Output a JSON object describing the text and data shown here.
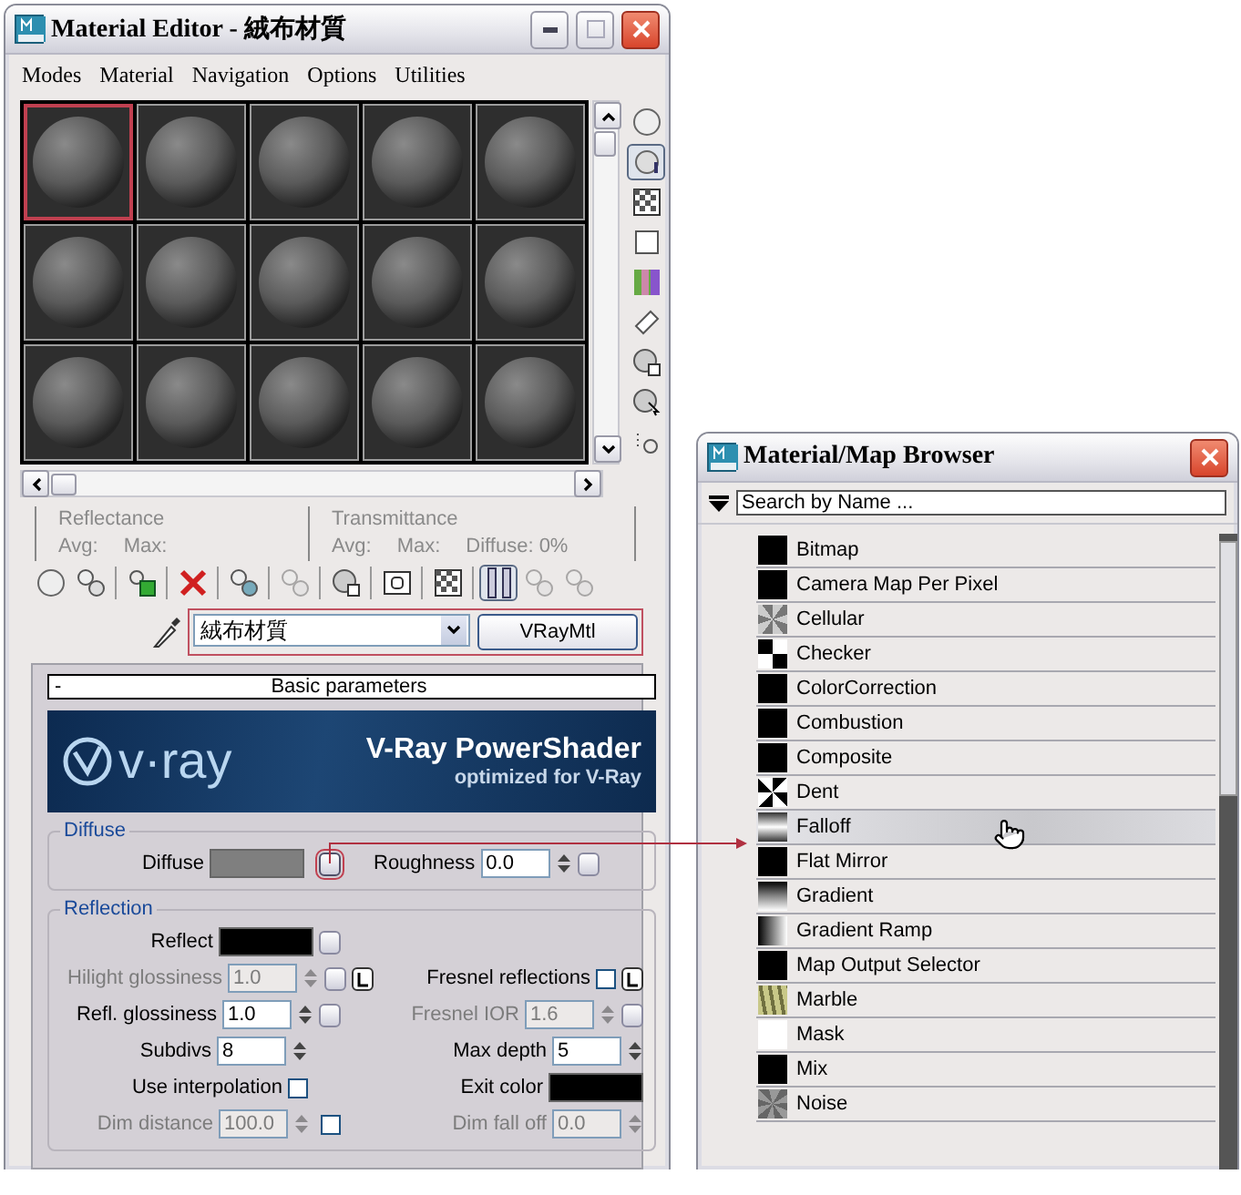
{
  "material_editor": {
    "title": "Material Editor - 絨布材質",
    "menu": [
      {
        "label": "Modes"
      },
      {
        "label": "Material"
      },
      {
        "label": "Navigation"
      },
      {
        "label": "Options"
      },
      {
        "label": "Utilities"
      }
    ],
    "slots": [
      {
        "selected": true
      },
      {
        "selected": false
      },
      {
        "selected": false
      },
      {
        "selected": false
      },
      {
        "selected": false
      },
      {
        "selected": false
      },
      {
        "selected": false
      },
      {
        "selected": false
      },
      {
        "selected": false
      },
      {
        "selected": false
      },
      {
        "selected": false
      },
      {
        "selected": false
      },
      {
        "selected": false
      },
      {
        "selected": false
      },
      {
        "selected": false
      }
    ],
    "side_tools": [
      {
        "kind": "sphere",
        "pressed": false
      },
      {
        "kind": "backlight",
        "pressed": true
      },
      {
        "kind": "checker",
        "pressed": false
      },
      {
        "kind": "square",
        "pressed": false
      },
      {
        "kind": "colors",
        "pressed": false
      },
      {
        "kind": "film",
        "pressed": false
      },
      {
        "kind": "options",
        "pressed": false
      },
      {
        "kind": "select",
        "pressed": false
      },
      {
        "kind": "dots",
        "pressed": false
      }
    ],
    "reflectance": {
      "label": "Reflectance",
      "avg": "Avg:",
      "max": "Max:"
    },
    "transmittance": {
      "label": "Transmittance",
      "avg": "Avg:",
      "max": "Max:",
      "diffuse": "Diffuse:",
      "diffuse_value": "0%"
    },
    "toolbar": [
      {
        "kind": "sphere",
        "pressed": false,
        "disabled": false
      },
      {
        "kind": "put",
        "pressed": false,
        "disabled": false
      },
      {
        "kind": "cube",
        "pressed": false,
        "disabled": false
      },
      {
        "kind": "delete",
        "pressed": false,
        "disabled": false
      },
      {
        "kind": "copy",
        "pressed": false,
        "disabled": false
      },
      {
        "kind": "unique",
        "pressed": false,
        "disabled": true
      },
      {
        "kind": "library",
        "pressed": false,
        "disabled": false
      },
      {
        "kind": "box",
        "pressed": false,
        "disabled": false
      },
      {
        "kind": "checker",
        "pressed": false,
        "disabled": false
      },
      {
        "kind": "bar",
        "pressed": true,
        "disabled": false
      },
      {
        "kind": "up",
        "pressed": false,
        "disabled": true
      },
      {
        "kind": "next",
        "pressed": false,
        "disabled": true
      }
    ],
    "material_name": "絨布材質",
    "material_type": "VRayMtl",
    "rollout": {
      "sign": "-",
      "title": "Basic parameters"
    },
    "banner": {
      "logo": "v·ray",
      "title": "V-Ray PowerShader",
      "subtitle": "optimized for V-Ray"
    },
    "diffuse": {
      "title": "Diffuse",
      "label": "Diffuse",
      "color": "#7f7f7f",
      "roughness_label": "Roughness",
      "roughness": "0.0"
    },
    "reflection": {
      "title": "Reflection",
      "rows": [
        [
          {
            "kind": "color",
            "label": "Reflect",
            "color": "#000000",
            "map": true,
            "lock": false,
            "disabled": false
          }
        ],
        [
          {
            "kind": "number",
            "label": "Hilight glossiness",
            "value": "1.0",
            "map": true,
            "lock": true,
            "disabled": true
          },
          {
            "kind": "checkbox",
            "label": "Fresnel reflections",
            "checked": false,
            "lock": true,
            "disabled": false
          }
        ],
        [
          {
            "kind": "number",
            "label": "Refl. glossiness",
            "value": "1.0",
            "map": true,
            "lock": false,
            "disabled": false
          },
          {
            "kind": "number",
            "label": "Fresnel IOR",
            "value": "1.6",
            "map": true,
            "lock": false,
            "disabled": true
          }
        ],
        [
          {
            "kind": "number",
            "label": "Subdivs",
            "value": "8",
            "map": false,
            "lock": false,
            "disabled": false
          },
          {
            "kind": "number",
            "label": "Max depth",
            "value": "5",
            "map": false,
            "lock": false,
            "disabled": false
          }
        ],
        [
          {
            "kind": "checkbox",
            "label": "Use interpolation",
            "checked": false,
            "lock": false,
            "disabled": false
          },
          {
            "kind": "color",
            "label": "Exit color",
            "color": "#000000",
            "map": false,
            "lock": false,
            "disabled": false
          }
        ],
        [
          {
            "kind": "number",
            "label": "Dim distance",
            "value": "100.0",
            "map": false,
            "toggle_checked": false,
            "lock": false,
            "disabled": true
          },
          {
            "kind": "number",
            "label": "Dim fall off",
            "value": "0.0",
            "map": false,
            "lock": false,
            "disabled": true
          }
        ]
      ]
    }
  },
  "browser": {
    "title": "Material/Map Browser",
    "search_placeholder": "Search by Name ...",
    "items": [
      {
        "name": "Bitmap",
        "kind": "solid",
        "highlighted": false
      },
      {
        "name": "Camera Map Per Pixel",
        "kind": "solid",
        "highlighted": false
      },
      {
        "name": "Cellular",
        "kind": "cellular",
        "highlighted": false
      },
      {
        "name": "Checker",
        "kind": "checker",
        "highlighted": false
      },
      {
        "name": "ColorCorrection",
        "kind": "solid",
        "highlighted": false
      },
      {
        "name": "Combustion",
        "kind": "solid",
        "highlighted": false
      },
      {
        "name": "Composite",
        "kind": "solid",
        "highlighted": false
      },
      {
        "name": "Dent",
        "kind": "dent",
        "highlighted": false
      },
      {
        "name": "Falloff",
        "kind": "falloff",
        "highlighted": true
      },
      {
        "name": "Flat Mirror",
        "kind": "solid",
        "highlighted": false
      },
      {
        "name": "Gradient",
        "kind": "gradient",
        "highlighted": false
      },
      {
        "name": "Gradient Ramp",
        "kind": "ramp",
        "highlighted": false
      },
      {
        "name": "Map Output Selector",
        "kind": "solid",
        "highlighted": false
      },
      {
        "name": "Marble",
        "kind": "marble",
        "highlighted": false
      },
      {
        "name": "Mask",
        "kind": "white",
        "highlighted": false
      },
      {
        "name": "Mix",
        "kind": "solid",
        "highlighted": false
      },
      {
        "name": "Noise",
        "kind": "noise",
        "highlighted": false
      }
    ]
  }
}
